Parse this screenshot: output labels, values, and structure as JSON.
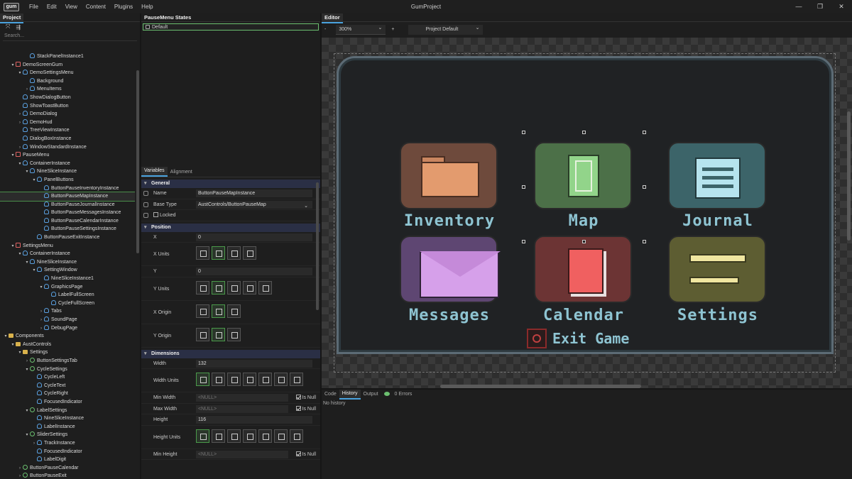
{
  "app": {
    "logo": "gum",
    "window_title": "GumProject"
  },
  "menu": [
    "File",
    "Edit",
    "View",
    "Content",
    "Plugins",
    "Help"
  ],
  "window_controls": {
    "minimize": "—",
    "maximize": "❐",
    "close": "✕"
  },
  "project": {
    "title": "Project",
    "search_placeholder": "Search...",
    "tree": [
      {
        "label": "StackPanelInstance1",
        "depth": 3,
        "icon": "inst",
        "arrow": ""
      },
      {
        "label": "DemoScreenGum",
        "depth": 1,
        "icon": "scr",
        "arrow": "▾"
      },
      {
        "label": "DemoSettingsMenu",
        "depth": 2,
        "icon": "inst",
        "arrow": "▾"
      },
      {
        "label": "Background",
        "depth": 3,
        "icon": "inst",
        "arrow": ""
      },
      {
        "label": "MenuItems",
        "depth": 3,
        "icon": "inst",
        "arrow": "›"
      },
      {
        "label": "ShowDialogButton",
        "depth": 2,
        "icon": "inst",
        "arrow": ""
      },
      {
        "label": "ShowToastButton",
        "depth": 2,
        "icon": "inst",
        "arrow": ""
      },
      {
        "label": "DemoDialog",
        "depth": 2,
        "icon": "inst",
        "arrow": "›"
      },
      {
        "label": "DemoHud",
        "depth": 2,
        "icon": "inst",
        "arrow": "›"
      },
      {
        "label": "TreeViewInstance",
        "depth": 2,
        "icon": "inst",
        "arrow": ""
      },
      {
        "label": "DialogBoxInstance",
        "depth": 2,
        "icon": "inst",
        "arrow": ""
      },
      {
        "label": "WindowStandardInstance",
        "depth": 2,
        "icon": "inst",
        "arrow": "›"
      },
      {
        "label": "PauseMenu",
        "depth": 1,
        "icon": "scr",
        "arrow": "▾"
      },
      {
        "label": "ContainerInstance",
        "depth": 2,
        "icon": "inst",
        "arrow": "▾"
      },
      {
        "label": "NineSliceInstance",
        "depth": 3,
        "icon": "inst",
        "arrow": "▾"
      },
      {
        "label": "PanelButtons",
        "depth": 4,
        "icon": "inst",
        "arrow": "▾"
      },
      {
        "label": "ButtonPauseInventoryInstance",
        "depth": 5,
        "icon": "inst",
        "arrow": ""
      },
      {
        "label": "ButtonPauseMapInstance",
        "depth": 5,
        "icon": "inst",
        "arrow": "",
        "selected": true
      },
      {
        "label": "ButtonPauseJournalInstance",
        "depth": 5,
        "icon": "inst",
        "arrow": ""
      },
      {
        "label": "ButtonPauseMessagesInstance",
        "depth": 5,
        "icon": "inst",
        "arrow": ""
      },
      {
        "label": "ButtonPauseCalendarInstance",
        "depth": 5,
        "icon": "inst",
        "arrow": ""
      },
      {
        "label": "ButtonPauseSettingsInstance",
        "depth": 5,
        "icon": "inst",
        "arrow": ""
      },
      {
        "label": "ButtonPauseExitInstance",
        "depth": 4,
        "icon": "inst",
        "arrow": ""
      },
      {
        "label": "SettingsMenu",
        "depth": 1,
        "icon": "scr",
        "arrow": "▾"
      },
      {
        "label": "ContainerInstance",
        "depth": 2,
        "icon": "inst",
        "arrow": "▾"
      },
      {
        "label": "NineSliceInstance",
        "depth": 3,
        "icon": "inst",
        "arrow": "▾"
      },
      {
        "label": "SettingWindow",
        "depth": 4,
        "icon": "inst",
        "arrow": "▾"
      },
      {
        "label": "NineSliceInstance1",
        "depth": 5,
        "icon": "inst",
        "arrow": ""
      },
      {
        "label": "GraphicsPage",
        "depth": 5,
        "icon": "inst",
        "arrow": "▾"
      },
      {
        "label": "LabelFullScreen",
        "depth": 6,
        "icon": "inst",
        "arrow": ""
      },
      {
        "label": "CycleFullScreen",
        "depth": 6,
        "icon": "inst",
        "arrow": ""
      },
      {
        "label": "Tabs",
        "depth": 5,
        "icon": "inst",
        "arrow": "›"
      },
      {
        "label": "SoundPage",
        "depth": 5,
        "icon": "inst",
        "arrow": "›"
      },
      {
        "label": "DebugPage",
        "depth": 5,
        "icon": "inst",
        "arrow": "›"
      },
      {
        "label": "Components",
        "depth": 0,
        "icon": "fold",
        "arrow": "▾"
      },
      {
        "label": "AustControls",
        "depth": 1,
        "icon": "fold",
        "arrow": "▾"
      },
      {
        "label": "Settings",
        "depth": 2,
        "icon": "fold",
        "arrow": "▾"
      },
      {
        "label": "ButtonSettingsTab",
        "depth": 3,
        "icon": "comp",
        "arrow": "›"
      },
      {
        "label": "CycleSettings",
        "depth": 3,
        "icon": "comp",
        "arrow": "▾"
      },
      {
        "label": "CycleLeft",
        "depth": 4,
        "icon": "inst",
        "arrow": ""
      },
      {
        "label": "CycleText",
        "depth": 4,
        "icon": "inst",
        "arrow": ""
      },
      {
        "label": "CycleRight",
        "depth": 4,
        "icon": "inst",
        "arrow": ""
      },
      {
        "label": "FocusedIndicator",
        "depth": 4,
        "icon": "inst",
        "arrow": ""
      },
      {
        "label": "LabelSettings",
        "depth": 3,
        "icon": "comp",
        "arrow": "▾"
      },
      {
        "label": "NineSliceInstance",
        "depth": 4,
        "icon": "inst",
        "arrow": ""
      },
      {
        "label": "LabelInstance",
        "depth": 4,
        "icon": "inst",
        "arrow": ""
      },
      {
        "label": "SliderSettings",
        "depth": 3,
        "icon": "comp",
        "arrow": "▾"
      },
      {
        "label": "TrackInstance",
        "depth": 4,
        "icon": "inst",
        "arrow": "›"
      },
      {
        "label": "FocusedIndicator",
        "depth": 4,
        "icon": "inst",
        "arrow": ""
      },
      {
        "label": "LabelDigit",
        "depth": 4,
        "icon": "inst",
        "arrow": ""
      },
      {
        "label": "ButtonPauseCalendar",
        "depth": 2,
        "icon": "comp",
        "arrow": "›"
      },
      {
        "label": "ButtonPauseExit",
        "depth": 2,
        "icon": "comp",
        "arrow": "›"
      }
    ]
  },
  "states": {
    "title": "PauseMenu States",
    "items": [
      "Default"
    ]
  },
  "variables": {
    "tabs": [
      "Variables",
      "Alignment"
    ],
    "general": {
      "title": "General",
      "name_label": "Name",
      "name_value": "ButtonPauseMapInstance",
      "base_label": "Base Type",
      "base_value": "AustControls/ButtonPauseMap",
      "locked_label": "Locked"
    },
    "position": {
      "title": "Position",
      "x_label": "X",
      "x_value": "0",
      "x_units": "X Units",
      "y_label": "Y",
      "y_value": "0",
      "y_units": "Y Units",
      "x_origin": "X Origin",
      "y_origin": "Y Origin"
    },
    "dimensions": {
      "title": "Dimensions",
      "width_label": "Width",
      "width_value": "132",
      "width_units": "Width Units",
      "min_width": "Min Width",
      "max_width": "Max Width",
      "null_text": "<NULL>",
      "is_null": "Is Null",
      "height_label": "Height",
      "height_value": "116",
      "height_units": "Height Units",
      "min_height": "Min Height"
    }
  },
  "editor": {
    "title": "Editor",
    "zoom": "300%",
    "zoom_minus": "-",
    "zoom_plus": "+",
    "project_default": "Project Default",
    "tiles": [
      {
        "label": "Inventory",
        "bg": "#6e4a3c",
        "icon": "folder-icon"
      },
      {
        "label": "Map",
        "bg": "#4c7048",
        "icon": "map-icon"
      },
      {
        "label": "Journal",
        "bg": "#3c6469",
        "icon": "notepad-icon"
      },
      {
        "label": "Messages",
        "bg": "#5e4672",
        "icon": "envelope-icon"
      },
      {
        "label": "Calendar",
        "bg": "#6c3434",
        "icon": "calendar-icon"
      },
      {
        "label": "Settings",
        "bg": "#5d5d32",
        "icon": "wrench-icon"
      }
    ],
    "exit_label": "Exit Game"
  },
  "bottom": {
    "tabs": [
      "Code",
      "History",
      "Output"
    ],
    "errors": "0 Errors",
    "history_text": "No history"
  },
  "colors": {
    "accent": "#4aa3df",
    "selection": "#4a8d4a",
    "label": "#8ec4d2"
  }
}
